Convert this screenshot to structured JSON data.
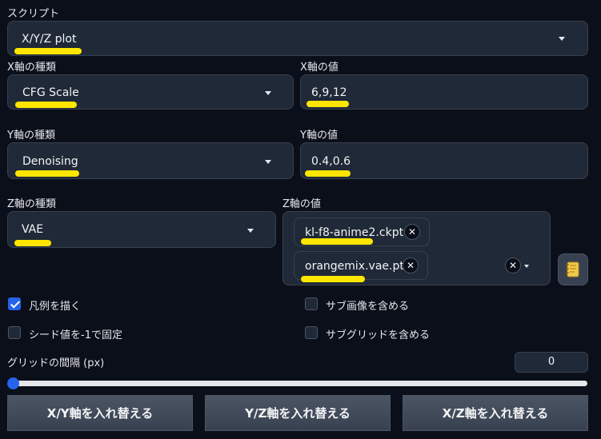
{
  "script": {
    "label": "スクリプト",
    "value": "X/Y/Z plot"
  },
  "x_axis": {
    "type_label": "X軸の種類",
    "type_value": "CFG Scale",
    "values_label": "X軸の値",
    "values_value": "6,9,12"
  },
  "y_axis": {
    "type_label": "Y軸の種類",
    "type_value": "Denoising",
    "values_label": "Y軸の値",
    "values_value": "0.4,0.6"
  },
  "z_axis": {
    "type_label": "Z軸の種類",
    "type_value": "VAE",
    "values_label": "Z軸の値",
    "chips": [
      "kl-f8-anime2.ckpt",
      "orangemix.vae.pt"
    ],
    "chip_remove_glyph": "✕",
    "clear_glyph": "✕"
  },
  "options": {
    "draw_legend": {
      "label": "凡例を描く",
      "checked": true
    },
    "include_sub_images": {
      "label": "サブ画像を含める",
      "checked": false
    },
    "fix_seed": {
      "label": "シード値を-1で固定",
      "checked": false
    },
    "include_sub_grids": {
      "label": "サブグリッドを含める",
      "checked": false
    }
  },
  "grid_margin": {
    "label": "グリッドの間隔 (px)",
    "value": "0",
    "slider_value": 0,
    "slider_min": 0
  },
  "buttons": {
    "swap_xy": "X/Y軸を入れ替える",
    "swap_yz": "Y/Z軸を入れ替える",
    "swap_xz": "X/Z軸を入れ替える"
  },
  "colors": {
    "background": "#0b0f19",
    "panel": "#1f2937",
    "border": "#374151",
    "highlight": "#ffe600",
    "accent": "#2563eb"
  },
  "icons": {
    "notebook": "notebook-icon",
    "dropdown": "chevron-down-icon",
    "remove": "close-icon",
    "check": "check-icon"
  }
}
